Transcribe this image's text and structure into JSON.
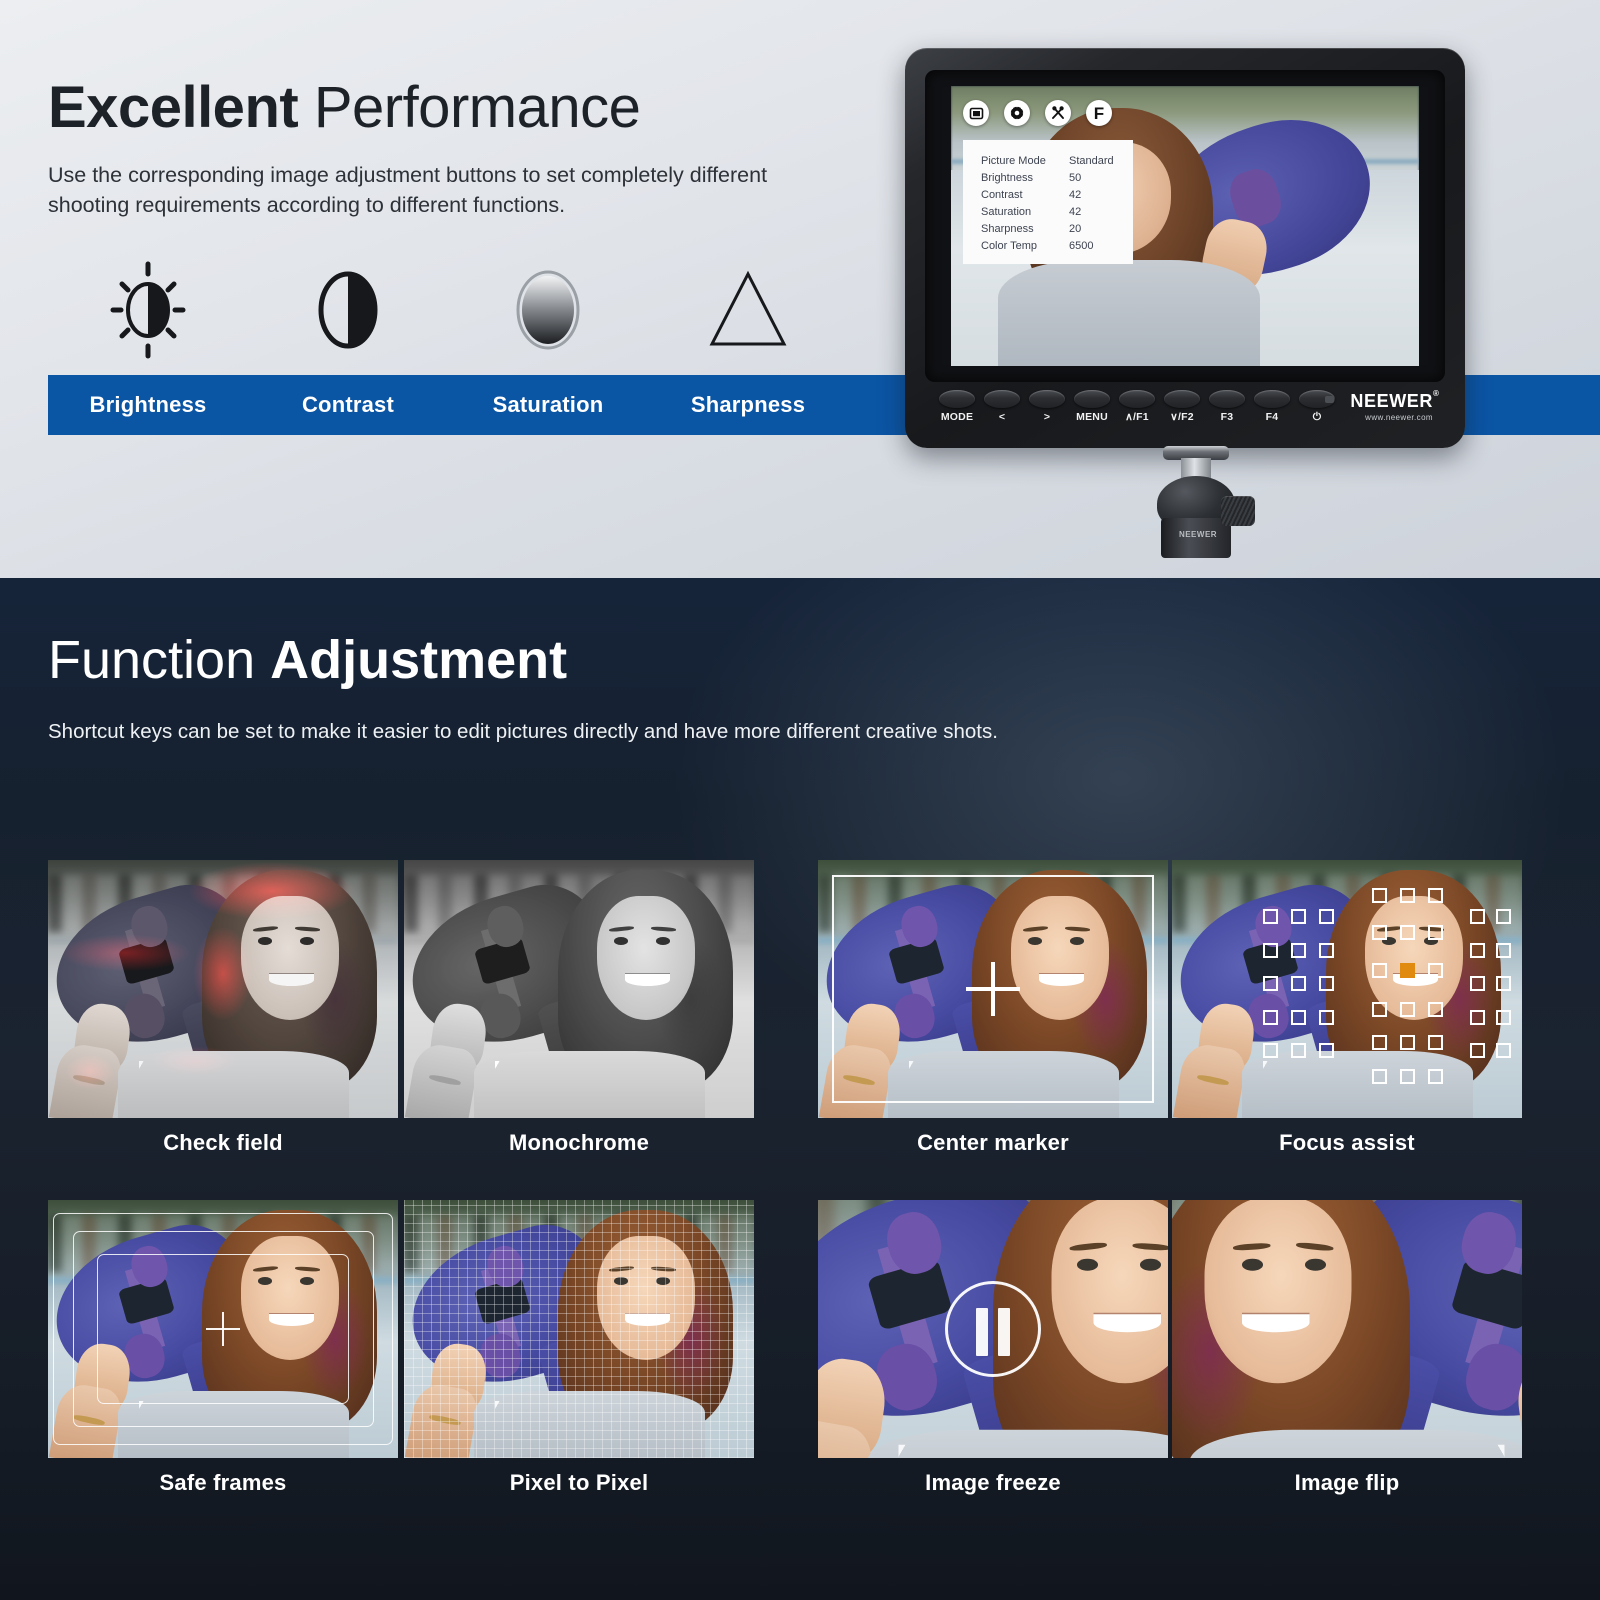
{
  "top": {
    "title_bold": "Excellent",
    "title_light": "Performance",
    "subtitle": "Use the corresponding image adjustment buttons to set completely different shooting requirements according to different functions.",
    "accent_color": "#0b55a5",
    "features": [
      {
        "label": "Brightness",
        "icon": "brightness-sun-icon"
      },
      {
        "label": "Contrast",
        "icon": "contrast-circle-icon"
      },
      {
        "label": "Saturation",
        "icon": "saturation-gradient-ellipse-icon"
      },
      {
        "label": "Sharpness",
        "icon": "sharpness-triangle-icon"
      }
    ]
  },
  "monitor": {
    "brand": "NEEWER",
    "brand_mark": "®",
    "brand_url": "www.neewer.com",
    "mount_brand": "NEEWER",
    "osd_icons": [
      {
        "name": "picture-icon",
        "glyph": "square"
      },
      {
        "name": "gear-icon",
        "glyph": "gear"
      },
      {
        "name": "tools-icon",
        "glyph": "wrench"
      },
      {
        "name": "function-icon",
        "glyph": "F"
      }
    ],
    "osd_menu": [
      {
        "key": "Picture Mode",
        "value": "Standard"
      },
      {
        "key": "Brightness",
        "value": "50"
      },
      {
        "key": "Contrast",
        "value": "42"
      },
      {
        "key": "Saturation",
        "value": "42"
      },
      {
        "key": "Sharpness",
        "value": "20"
      },
      {
        "key": "Color Temp",
        "value": "6500"
      }
    ],
    "buttons": [
      "MODE",
      "<",
      ">",
      "MENU",
      "∧/F1",
      "∨/F2",
      "F3",
      "F4",
      "⏻"
    ]
  },
  "bottom": {
    "title_light": "Function",
    "title_bold": "Adjustment",
    "subtitle": "Shortcut keys can be set to make it easier to edit pictures directly and have more different creative shots.",
    "panels": [
      {
        "caption": "Check field",
        "mode": "check-field"
      },
      {
        "caption": "Monochrome",
        "mode": "monochrome"
      },
      {
        "caption": "Center marker",
        "mode": "center-marker"
      },
      {
        "caption": "Focus assist",
        "mode": "focus-assist"
      },
      {
        "caption": "Safe frames",
        "mode": "safe-frames"
      },
      {
        "caption": "Pixel to Pixel",
        "mode": "pixel-to-pixel"
      },
      {
        "caption": "Image freeze",
        "mode": "image-freeze"
      },
      {
        "caption": "Image flip",
        "mode": "image-flip"
      }
    ]
  }
}
